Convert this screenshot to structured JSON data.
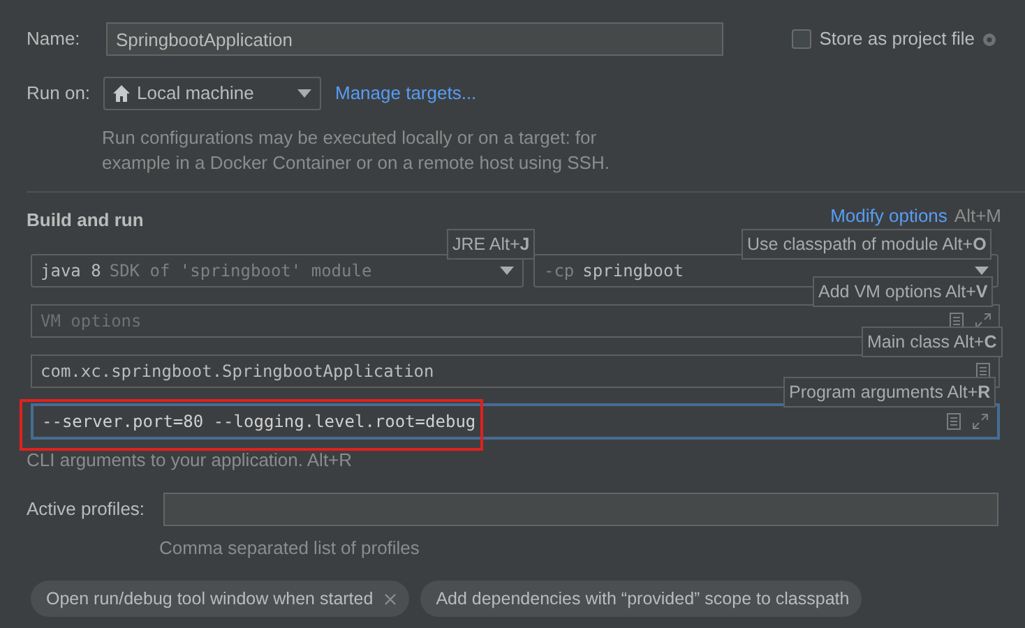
{
  "name_field": {
    "label": "Name:",
    "value": "SpringbootApplication"
  },
  "store_as_project_file": {
    "label": "Store as project file",
    "checked": false
  },
  "run_on": {
    "label": "Run on:",
    "value": "Local machine",
    "link": "Manage targets...",
    "description": "Run configurations may be executed locally or on a target: for example in a Docker Container or on a remote host using SSH."
  },
  "build_and_run": {
    "title": "Build and run",
    "modify_options": "Modify options",
    "modify_shortcut": "Alt+M",
    "jre": {
      "value": "java 8",
      "hint": "SDK of 'springboot' module"
    },
    "classpath": {
      "prefix": "-cp",
      "value": "springboot"
    },
    "vm_options": {
      "placeholder": "VM options"
    },
    "main_class": {
      "value": "com.xc.springboot.SpringbootApplication"
    },
    "program_arguments": {
      "value": "--server.port=80 --logging.level.root=debug",
      "focused": true
    },
    "program_arguments_hint": "CLI arguments to your application. Alt+R"
  },
  "tooltips": [
    {
      "text": "JRE Alt+**J**"
    },
    {
      "text": "Use classpath of module Alt+**O**"
    },
    {
      "text": "Add VM options Alt+**V**"
    },
    {
      "text": "Main class Alt+**C**"
    },
    {
      "text": "Program arguments Alt+**R**"
    }
  ],
  "active_profiles": {
    "label": "Active profiles:",
    "hint": "Comma separated list of profiles"
  },
  "chips": [
    {
      "label": "Open run/debug tool window when started",
      "removable": true
    },
    {
      "label": "Add dependencies with “provided” scope to classpath",
      "removable": false
    }
  ]
}
